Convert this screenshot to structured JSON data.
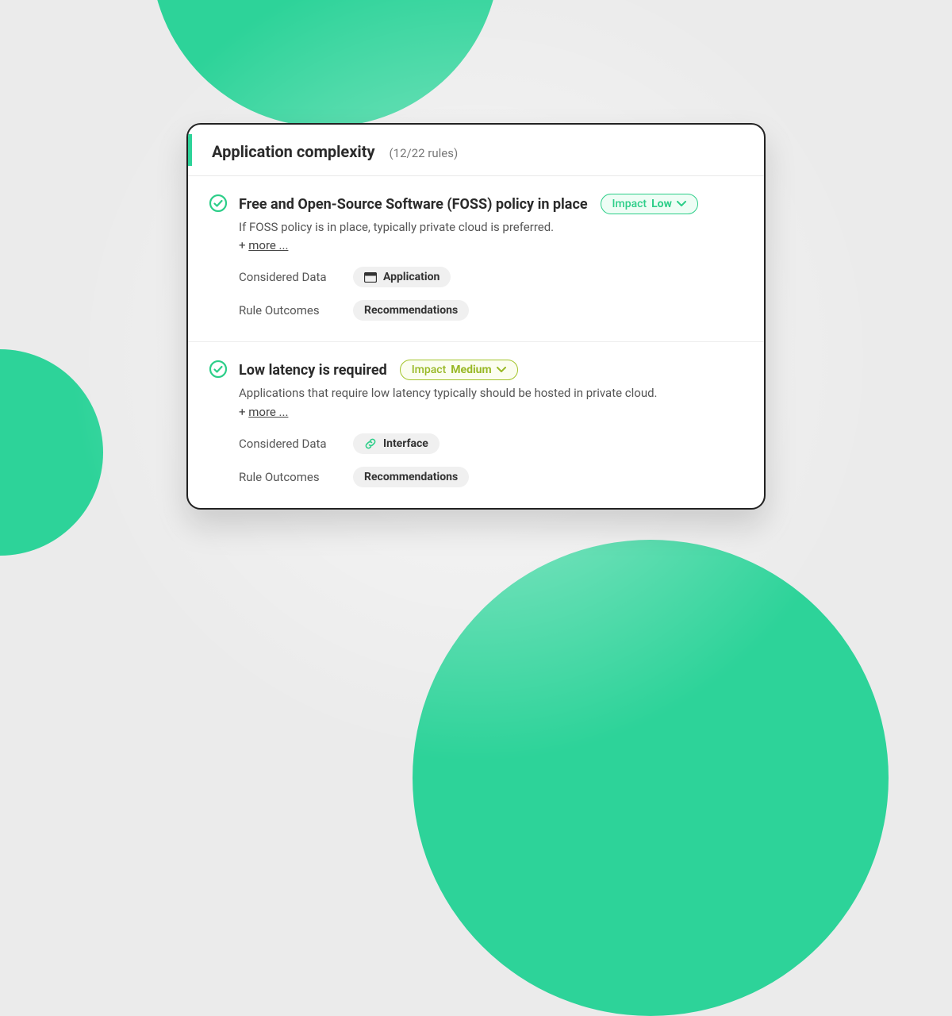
{
  "header": {
    "title": "Application complexity",
    "count": "(12/22 rules)"
  },
  "labels": {
    "impact": "Impact",
    "more_prefix": "+ ",
    "more": "more ...",
    "considered_data": "Considered Data",
    "rule_outcomes": "Rule Outcomes"
  },
  "rules": [
    {
      "title": "Free and Open-Source Software (FOSS) policy in place",
      "impact_level": "Low",
      "impact_style": "low",
      "description": "If FOSS policy is in place, typically private cloud is preferred.",
      "considered": {
        "icon": "app",
        "label": "Application"
      },
      "outcome": "Recommendations"
    },
    {
      "title": "Low latency is required",
      "impact_level": "Medium",
      "impact_style": "medium",
      "description": "Applications that require low latency typically should be hosted in private cloud.",
      "considered": {
        "icon": "link",
        "label": "Interface"
      },
      "outcome": "Recommendations"
    }
  ],
  "colors": {
    "accent": "#2dd399",
    "low": "#2dce89",
    "medium": "#98b825"
  }
}
